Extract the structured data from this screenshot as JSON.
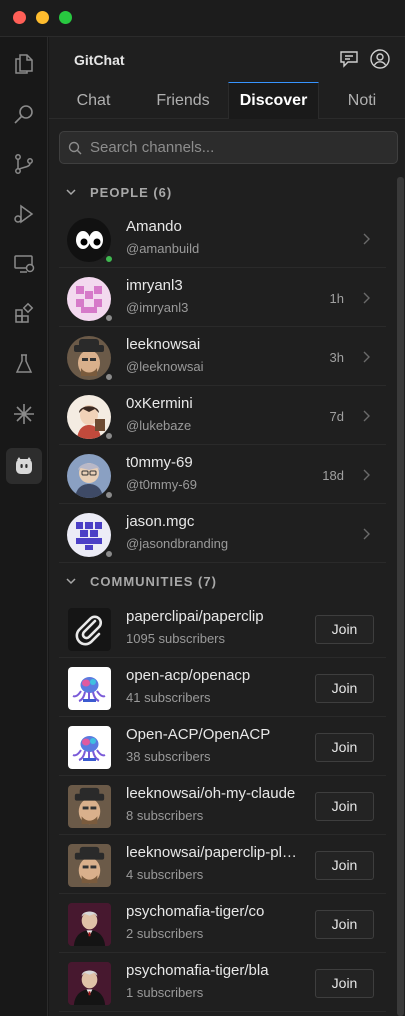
{
  "app": {
    "title": "GitChat"
  },
  "tabs": [
    {
      "label": "Chat"
    },
    {
      "label": "Friends"
    },
    {
      "label": "Discover"
    },
    {
      "label": "Noti"
    }
  ],
  "active_tab": "Discover",
  "search": {
    "placeholder": "Search channels..."
  },
  "people": {
    "header": "PEOPLE (6)",
    "items": [
      {
        "name": "Amando",
        "handle": "@amanbuild",
        "time": "",
        "status": "online",
        "avatar": "eyes-avatar"
      },
      {
        "name": "imryanl3",
        "handle": "@imryanl3",
        "time": "1h",
        "status": "offline",
        "avatar": "pink-identicon"
      },
      {
        "name": "leeknowsai",
        "handle": "@leeknowsai",
        "time": "3h",
        "status": "offline",
        "avatar": "man-hat-avatar"
      },
      {
        "name": "0xKermini",
        "handle": "@lukebaze",
        "time": "7d",
        "status": "offline",
        "avatar": "anime-avatar"
      },
      {
        "name": "t0mmy-69",
        "handle": "@t0mmy-69",
        "time": "18d",
        "status": "offline",
        "avatar": "cartoon-avatar"
      },
      {
        "name": "jason.mgc",
        "handle": "@jasondbranding",
        "time": "",
        "status": "offline",
        "avatar": "purple-identicon"
      }
    ]
  },
  "communities": {
    "header": "COMMUNITIES (7)",
    "join_label": "Join",
    "items": [
      {
        "name": "paperclipai/paperclip",
        "subscribers": "1095 subscribers",
        "avatar": "paperclip-icon"
      },
      {
        "name": "open-acp/openacp",
        "subscribers": "41 subscribers",
        "avatar": "octopus-logo"
      },
      {
        "name": "Open-ACP/OpenACP",
        "subscribers": "38 subscribers",
        "avatar": "octopus-logo"
      },
      {
        "name": "leeknowsai/oh-my-claude",
        "subscribers": "8 subscribers",
        "avatar": "man-hat-avatar"
      },
      {
        "name": "leeknowsai/paperclip-plugins",
        "subscribers": "4 subscribers",
        "avatar": "man-hat-avatar"
      },
      {
        "name": "psychomafia-tiger/co",
        "subscribers": "2 subscribers",
        "avatar": "mafia-avatar"
      },
      {
        "name": "psychomafia-tiger/bla",
        "subscribers": "1 subscribers",
        "avatar": "mafia-avatar"
      }
    ]
  },
  "colors": {
    "accent": "#3794ff",
    "online": "#3fb950",
    "offline": "#8b8b8b"
  }
}
